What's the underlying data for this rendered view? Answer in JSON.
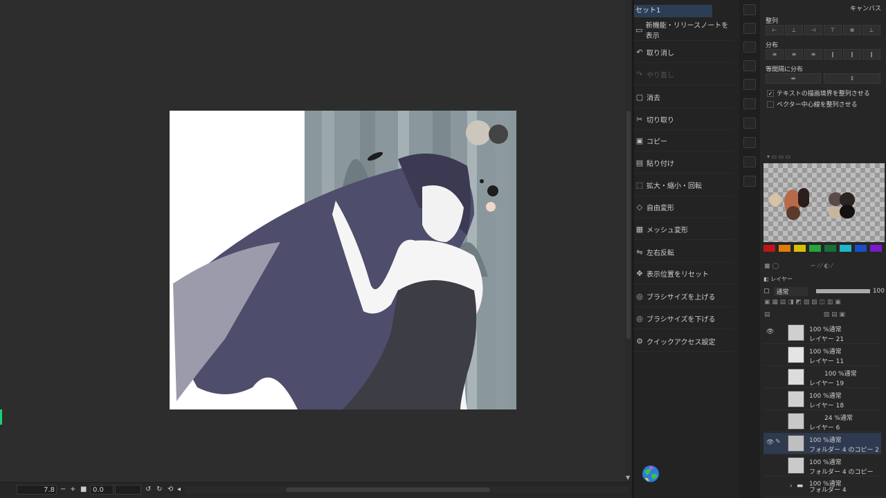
{
  "quick_access": {
    "set_tab": "セット1",
    "items": [
      {
        "label": "新機能・リリースノートを表示",
        "icon": "news-icon",
        "disabled": false
      },
      {
        "label": "取り消し",
        "icon": "undo-icon",
        "disabled": false
      },
      {
        "label": "やり直し",
        "icon": "redo-icon",
        "disabled": true
      },
      {
        "label": "消去",
        "icon": "clear-icon",
        "disabled": false
      },
      {
        "label": "切り取り",
        "icon": "cut-icon",
        "disabled": false
      },
      {
        "label": "コピー",
        "icon": "copy-icon",
        "disabled": false
      },
      {
        "label": "貼り付け",
        "icon": "paste-icon",
        "disabled": false
      },
      {
        "label": "拡大・縮小・回転",
        "icon": "transform-icon",
        "disabled": false
      },
      {
        "label": "自由変形",
        "icon": "free-transform-icon",
        "disabled": false
      },
      {
        "label": "メッシュ変形",
        "icon": "mesh-icon",
        "disabled": false
      },
      {
        "label": "左右反転",
        "icon": "flip-icon",
        "disabled": false
      },
      {
        "label": "表示位置をリセット",
        "icon": "reset-view-icon",
        "disabled": false
      },
      {
        "label": "ブラシサイズを上げる",
        "icon": "brush-up-icon",
        "disabled": false
      },
      {
        "label": "ブラシサイズを下げる",
        "icon": "brush-down-icon",
        "disabled": false
      },
      {
        "label": "クイックアクセス設定",
        "icon": "settings-icon",
        "disabled": false
      }
    ]
  },
  "align_panel": {
    "canvas_tab": "キャンバス",
    "align_label": "整列",
    "distribute_label": "分布",
    "equal_spacing_label": "等間隔に分布",
    "option1": "テキストの描画境界を整列させる",
    "option1_checked": true,
    "option2": "ベクター中心線を整列させる",
    "option2_checked": false
  },
  "color_strip": [
    "#c0141a",
    "#e07b0a",
    "#d8c00a",
    "#27a43a",
    "#1a6e3a",
    "#1ab8c8",
    "#1a4ec8",
    "#7a1ac8",
    "#c81aa8"
  ],
  "layers": {
    "header": "レイヤー",
    "blend_mode": "通常",
    "opacity": "100",
    "items": [
      {
        "mode": "100 %通常",
        "name": "レイヤー 21",
        "visible": true,
        "selected": false
      },
      {
        "mode": "100 %通常",
        "name": "レイヤー 11",
        "visible": false,
        "selected": false
      },
      {
        "mode": "100 %通常",
        "name": "レイヤー 19",
        "visible": false,
        "selected": false
      },
      {
        "mode": "100 %通常",
        "name": "レイヤー 18",
        "visible": false,
        "selected": false
      },
      {
        "mode": "24 %通常",
        "name": "レイヤー 6",
        "visible": false,
        "selected": false
      },
      {
        "mode": "100 %通常",
        "name": "フォルダー 4 のコピー 2",
        "visible": true,
        "selected": true
      },
      {
        "mode": "100 %通常",
        "name": "フォルダー 4 のコピー",
        "visible": false,
        "selected": false
      },
      {
        "mode": "100 %通常",
        "name": "フォルダー 4",
        "visible": false,
        "selected": false
      }
    ]
  },
  "status_bar": {
    "zoom": "7.8",
    "rotation": "0.0"
  }
}
